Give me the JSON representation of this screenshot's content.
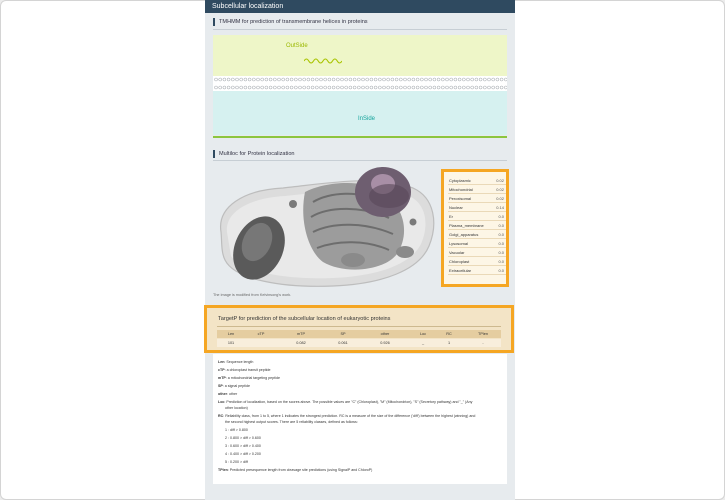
{
  "header": {
    "title": "Subcellular localization"
  },
  "tmhmm": {
    "title": "TMHMM for prediction of transmembrane helices in proteins",
    "outside_label": "OutSide",
    "inside_label": "InSide",
    "colors": {
      "outside": "#eef6c8",
      "inside": "#d6f1f0",
      "baseline": "#8cc63f",
      "helix": "#a9c400"
    }
  },
  "multiloc": {
    "title": "Multiloc for Protein localization",
    "image_caption": "The image is modified from Kelvinsong's work.",
    "locations": [
      {
        "name": "Cytoplasmic",
        "value": "0.02"
      },
      {
        "name": "Mitochondrial",
        "value": "0.02"
      },
      {
        "name": "Peroxisomal",
        "value": "0.02"
      },
      {
        "name": "Nuclear",
        "value": "0.14"
      },
      {
        "name": "Er",
        "value": "0.0"
      },
      {
        "name": "Plasma_membrane",
        "value": "0.0"
      },
      {
        "name": "Golgi_apparatus",
        "value": "0.0"
      },
      {
        "name": "Lysosomal",
        "value": "0.0"
      },
      {
        "name": "Vacuolar",
        "value": "0.0"
      },
      {
        "name": "Chloroplast",
        "value": "0.0"
      },
      {
        "name": "Extracellular",
        "value": "0.0"
      }
    ]
  },
  "targetp": {
    "title": "TargetP for prediction of the subcellular location of eukaryotic proteins",
    "columns": [
      "Len",
      "cTP",
      "mTP",
      "SP",
      "other",
      "Loc",
      "RC",
      "TPlen"
    ],
    "row": [
      "101",
      "",
      "0.082",
      "0.061",
      "0.926",
      "_",
      "1",
      "-"
    ]
  },
  "legend": {
    "lines": [
      {
        "key": "Len",
        "text": ": Sequence length"
      },
      {
        "key": "cTP",
        "text": ": a chloroplast transit peptide"
      },
      {
        "key": "mTP",
        "text": ": a mitochondrial targeting peptide"
      },
      {
        "key": "SP",
        "text": ": a signal peptide"
      },
      {
        "key": "other",
        "text": ": other"
      },
      {
        "key": "Loc",
        "text": ": Prediction of localization, based on the scores above. The possible values are \"C\" (Chloroplast), \"M\" (Mitochondrion), \"S\" (Secretory pathway) and \"_\" (Any"
      },
      {
        "key": "",
        "text": "other location)"
      },
      {
        "key": "RC",
        "text": ": Reliability class, from 1 to 5, where 1 indicates the strongest prediction. RC is a measure of the size of the difference ('diff') between the highest (winning) and"
      },
      {
        "key": "",
        "text": "the second highest output scores. There are 5 reliability classes, defined as follows:"
      },
      {
        "key": "",
        "text": "1 : diff > 0.800",
        "indent": true
      },
      {
        "key": "",
        "text": "2 : 0.800 > diff > 0.600",
        "indent": true
      },
      {
        "key": "",
        "text": "3 : 0.600 > diff > 0.400",
        "indent": true
      },
      {
        "key": "",
        "text": "4 : 0.400 > diff > 0.200",
        "indent": true
      },
      {
        "key": "",
        "text": "5 : 0.200 > diff",
        "indent": true
      },
      {
        "key": "TPlen",
        "text": ": Predicted presequence length from cleavage site predictions (using SignalP and ChloroP)"
      }
    ]
  },
  "colors": {
    "accent": "#f5a623",
    "header": "#2f4a60"
  }
}
